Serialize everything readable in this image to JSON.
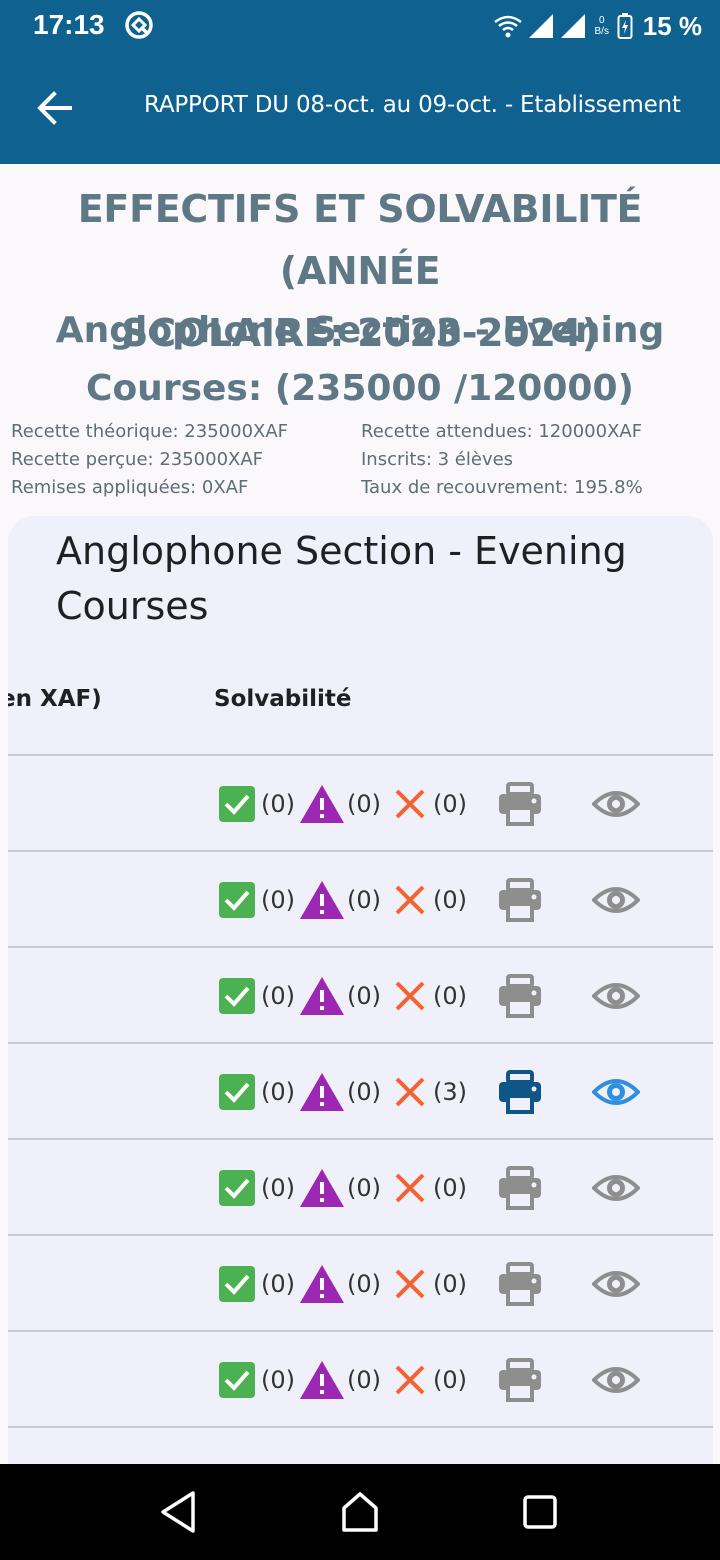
{
  "status_bar": {
    "time": "17:13",
    "net_speed_value": "0",
    "net_speed_unit": "B/s",
    "battery": "15 %"
  },
  "app_bar": {
    "title": "RAPPORT DU 08-oct. au 09-oct. - Etablissement"
  },
  "report": {
    "heading_line1": "EFFECTIFS ET SOLVABILITÉ (ANNÉE",
    "heading_line2": "SCOLAIRE: 2023-2024)",
    "section_line1": "Anglophone Section - Evening",
    "section_line2": "Courses: (235000 /120000)",
    "stats": {
      "recette_theorique": "Recette théorique: 235000XAF",
      "recette_attendues": "Recette attendues: 120000XAF",
      "recette_percue": "Recette perçue: 235000XAF",
      "inscrits": "Inscrits: 3 élèves",
      "remises": "Remises appliquées: 0XAF",
      "taux": "Taux de recouvrement: 195.8%"
    }
  },
  "card": {
    "title": "Anglophone Section - Evening Courses",
    "col_amount": "en XAF)",
    "col_solvability": "Solvabilité"
  },
  "rows": [
    {
      "ok": "(0)",
      "warn": "(0)",
      "ko": "(0)",
      "active": false
    },
    {
      "ok": "(0)",
      "warn": "(0)",
      "ko": "(0)",
      "active": false
    },
    {
      "ok": "(0)",
      "warn": "(0)",
      "ko": "(0)",
      "active": false
    },
    {
      "ok": "(0)",
      "warn": "(0)",
      "ko": "(3)",
      "active": true
    },
    {
      "ok": "(0)",
      "warn": "(0)",
      "ko": "(0)",
      "active": false
    },
    {
      "ok": "(0)",
      "warn": "(0)",
      "ko": "(0)",
      "active": false
    },
    {
      "ok": "(0)",
      "warn": "(0)",
      "ko": "(0)",
      "active": false
    }
  ],
  "colors": {
    "primary": "#0f6190",
    "heading": "#5f7886",
    "ok_green": "#4cb152",
    "warn_purple": "#9c27b0",
    "ko_orange": "#f4632f",
    "icon_inactive": "#8e8e8e",
    "print_active": "#0f5688",
    "view_active": "#2f8fdf"
  },
  "icons": {
    "back": "arrow-left-icon",
    "ok": "check-square-icon",
    "warn": "warning-triangle-icon",
    "ko": "x-icon",
    "print": "printer-icon",
    "view": "eye-icon"
  }
}
